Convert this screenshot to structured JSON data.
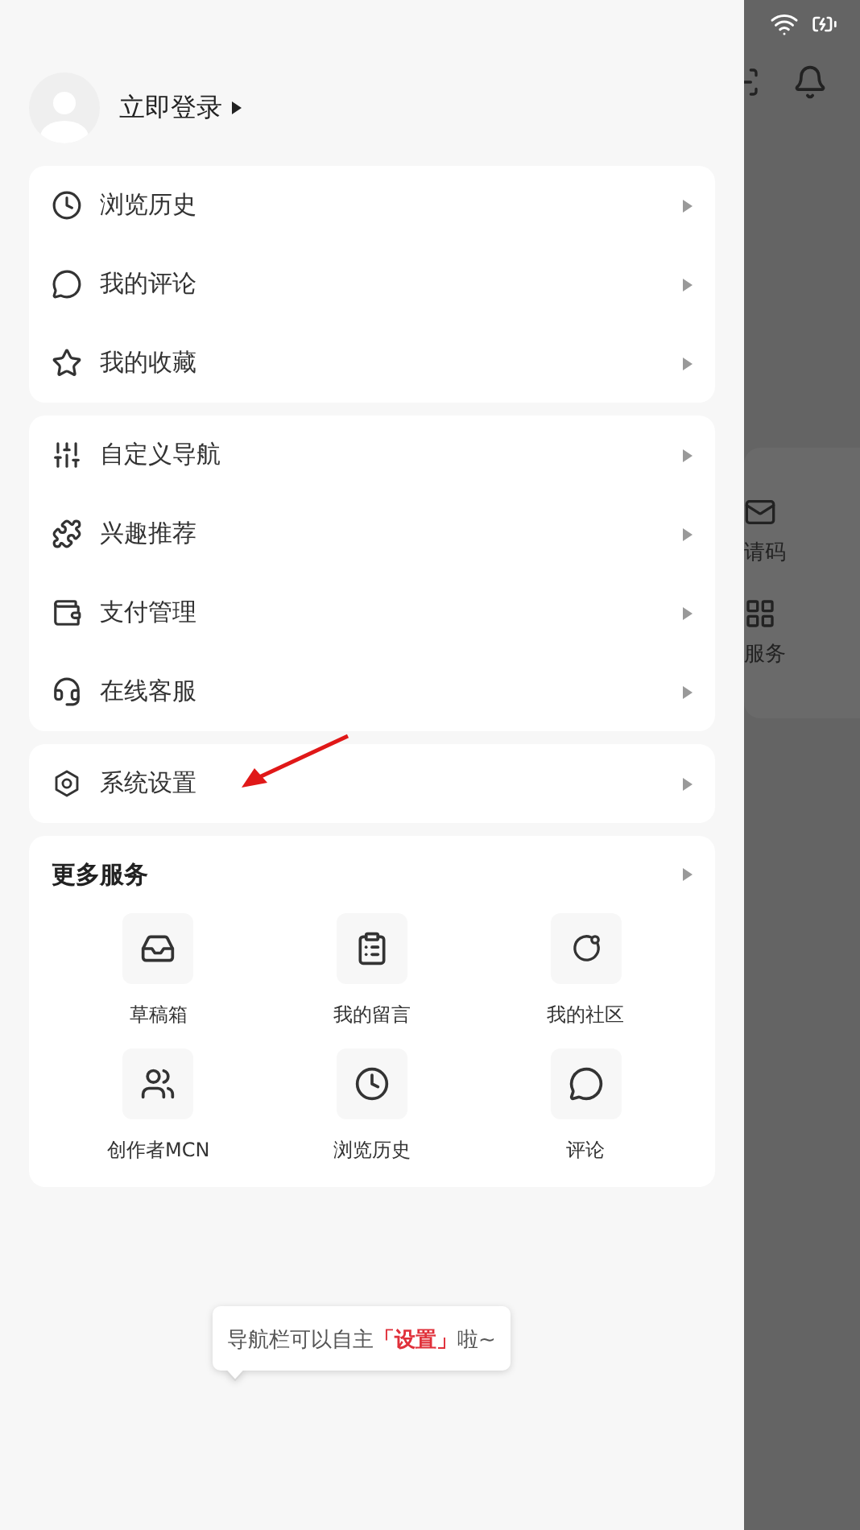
{
  "profile": {
    "label": "立即登录"
  },
  "menu_groups": [
    {
      "items": [
        {
          "label": "浏览历史"
        },
        {
          "label": "我的评论"
        },
        {
          "label": "我的收藏"
        }
      ]
    },
    {
      "items": [
        {
          "label": "自定义导航"
        },
        {
          "label": "兴趣推荐"
        },
        {
          "label": "支付管理"
        },
        {
          "label": "在线客服"
        }
      ]
    },
    {
      "items": [
        {
          "label": "系统设置"
        }
      ]
    }
  ],
  "more_services": {
    "title": "更多服务",
    "items": [
      {
        "label": "草稿箱"
      },
      {
        "label": "我的留言"
      },
      {
        "label": "我的社区"
      },
      {
        "label": "创作者MCN"
      },
      {
        "label": "浏览历史"
      },
      {
        "label": "评论"
      }
    ]
  },
  "tooltip": {
    "before": "导航栏可以自主",
    "highlight": "「设置」",
    "after": "啦~"
  },
  "background_page": {
    "labels": [
      "请码",
      "服务"
    ]
  }
}
